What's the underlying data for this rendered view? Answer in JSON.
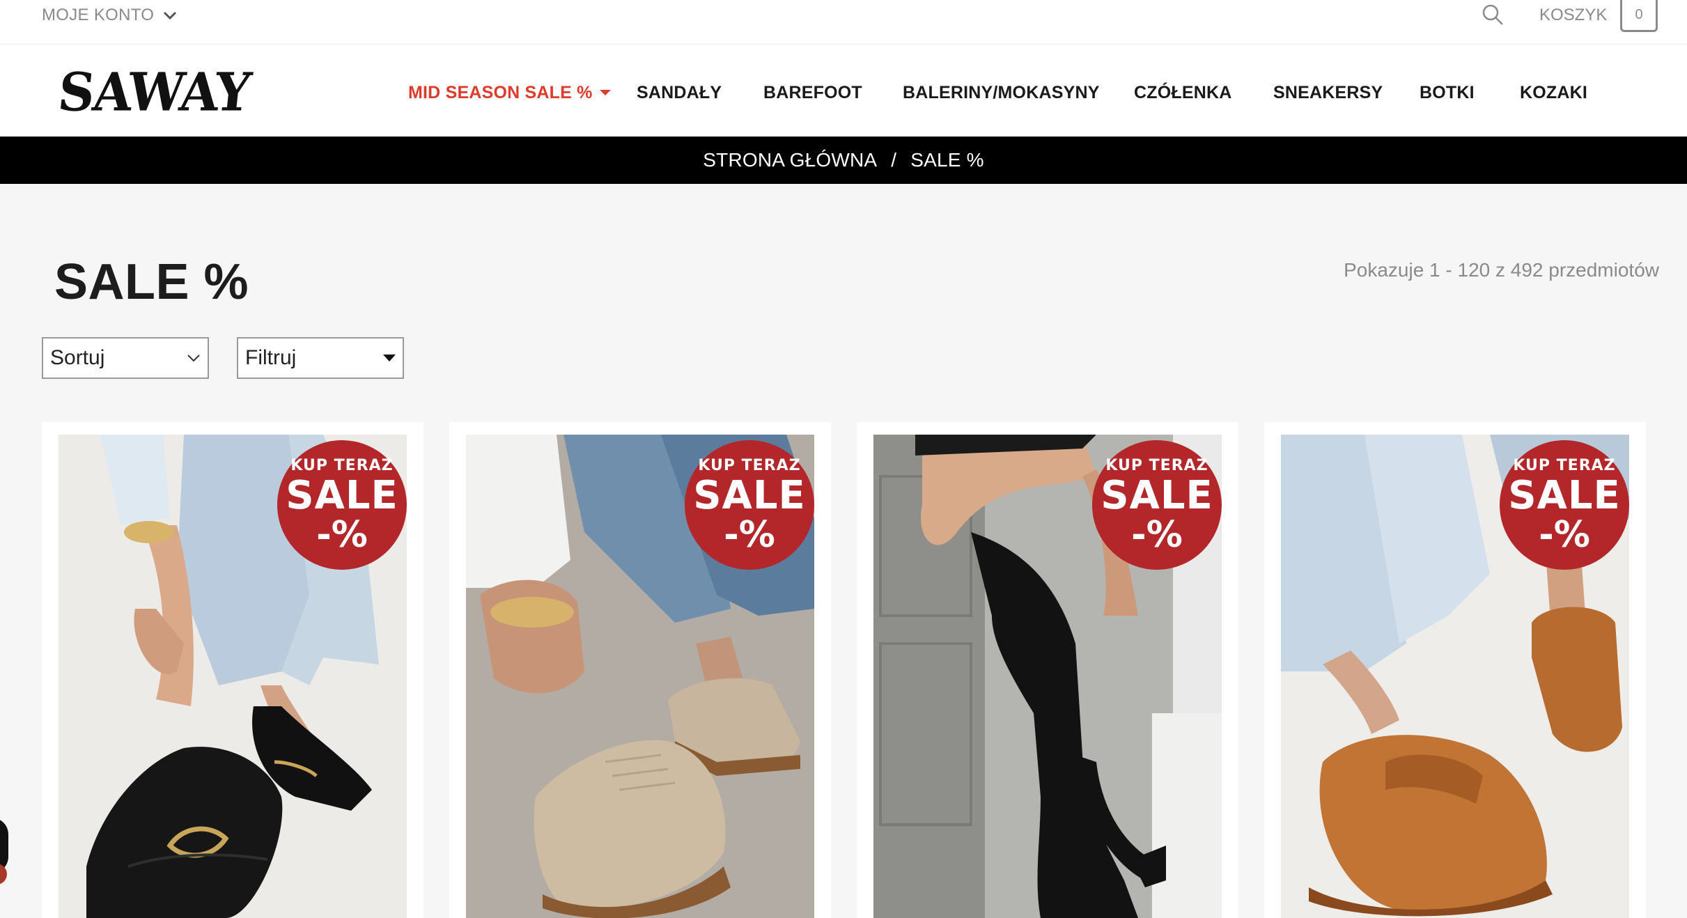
{
  "topbar": {
    "account_label": "MOJE KONTO",
    "cart_label": "KOSZYK",
    "cart_count": "0"
  },
  "header": {
    "logo_text": "SAWAY",
    "nav": [
      {
        "label": "MID SEASON SALE %"
      },
      {
        "label": "SANDAŁY"
      },
      {
        "label": "BAREFOOT"
      },
      {
        "label": "BALERINY/MOKASYNY"
      },
      {
        "label": "CZÓŁENKA"
      },
      {
        "label": "SNEAKERSY"
      },
      {
        "label": "BOTKI"
      },
      {
        "label": "KOZAKI"
      }
    ]
  },
  "breadcrumb": {
    "home": "STRONA GŁÓWNA",
    "separator": "/",
    "current": "SALE %"
  },
  "page": {
    "title": "SALE %",
    "result_count": "Pokazuje 1 - 120 z 492 przedmiotów",
    "sort_label": "Sortuj",
    "filter_label": "Filtruj"
  },
  "badge": {
    "line1": "KUP TERAZ",
    "line2": "SALE",
    "line3": "-%"
  },
  "products": [
    {
      "image": "black-loafer-with-gold-buckle"
    },
    {
      "image": "beige-suede-sneaker"
    },
    {
      "image": "black-knee-high-boot"
    },
    {
      "image": "cognac-leather-loafer"
    }
  ],
  "colors": {
    "sale_red": "#e03a2b",
    "badge_red": "#b3262a",
    "breadcrumb_bg": "#000000"
  }
}
